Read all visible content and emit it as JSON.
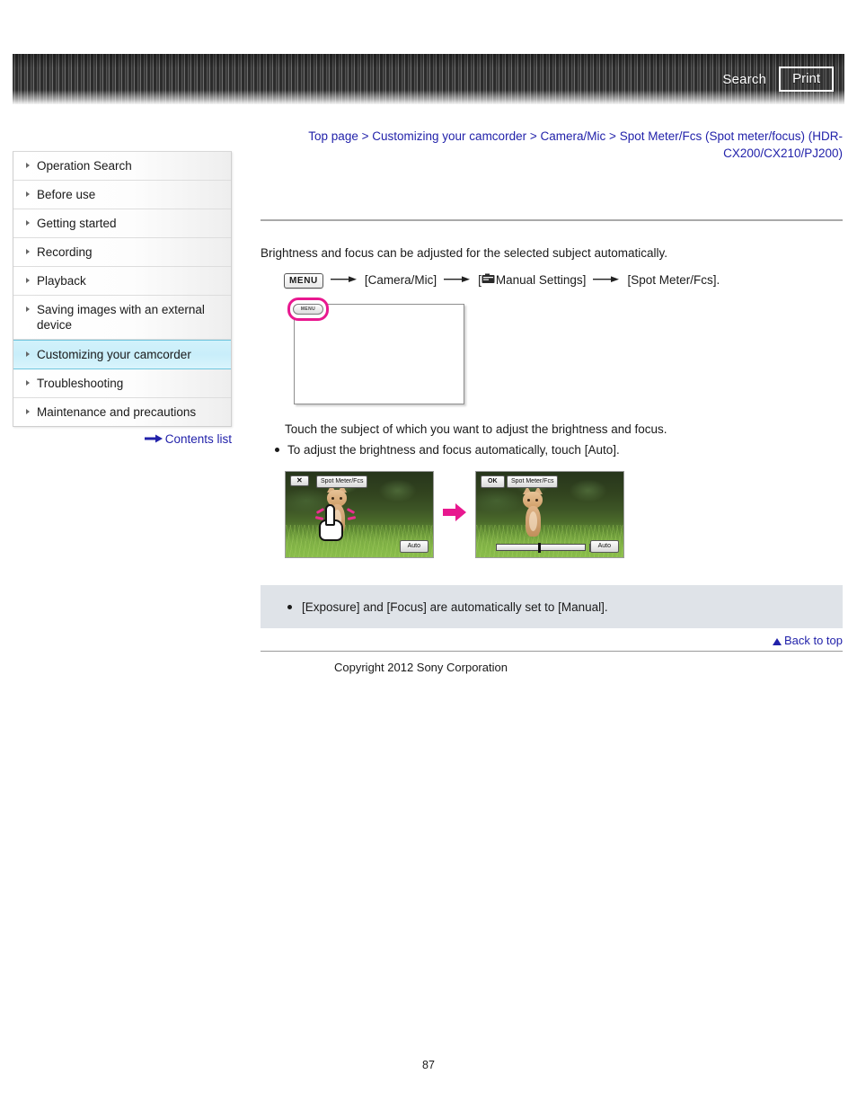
{
  "header": {
    "search_label": "Search",
    "print_label": "Print"
  },
  "breadcrumb": {
    "items": [
      "Top page",
      "Customizing your camcorder",
      "Camera/Mic",
      "Spot Meter/Fcs (Spot meter/focus) (HDR-CX200/CX210/PJ200)"
    ],
    "separator": ">"
  },
  "sidebar": {
    "items": [
      {
        "label": "Operation Search",
        "active": false
      },
      {
        "label": "Before use",
        "active": false
      },
      {
        "label": "Getting started",
        "active": false
      },
      {
        "label": "Recording",
        "active": false
      },
      {
        "label": "Playback",
        "active": false
      },
      {
        "label": "Saving images with an external device",
        "active": false
      },
      {
        "label": "Customizing your camcorder",
        "active": true
      },
      {
        "label": "Troubleshooting",
        "active": false
      },
      {
        "label": "Maintenance and precautions",
        "active": false
      }
    ],
    "contents_list_label": "Contents list"
  },
  "main": {
    "lead": "Brightness and focus can be adjusted for the selected subject automatically.",
    "menu_path": {
      "menu_badge": "MENU",
      "step1": "[Camera/Mic]",
      "step2_prefix": "[",
      "step2": "Manual Settings]",
      "step3": "[Spot Meter/Fcs].",
      "arrow": "→"
    },
    "screen_illustration": {
      "menu_button_label": "MENU"
    },
    "touch_instruction": "Touch the subject of which you want to adjust the brightness and focus.",
    "auto_bullet": "To adjust the brightness and focus automatically, touch [Auto].",
    "shots": [
      {
        "corner_button": "✕",
        "title_label": "Spot Meter/Fcs",
        "auto_label": "Auto"
      },
      {
        "corner_button": "OK",
        "title_label": "Spot Meter/Fcs",
        "auto_label": "Auto"
      }
    ],
    "note": "[Exposure] and [Focus] are automatically set to [Manual].",
    "back_to_top": "Back to top",
    "copyright": "Copyright 2012 Sony Corporation"
  },
  "page_number": "87",
  "colors": {
    "link": "#2222aa",
    "active_nav": "#cdeefa",
    "accent_pink": "#e8188f",
    "note_bg": "#dfe3e8"
  }
}
